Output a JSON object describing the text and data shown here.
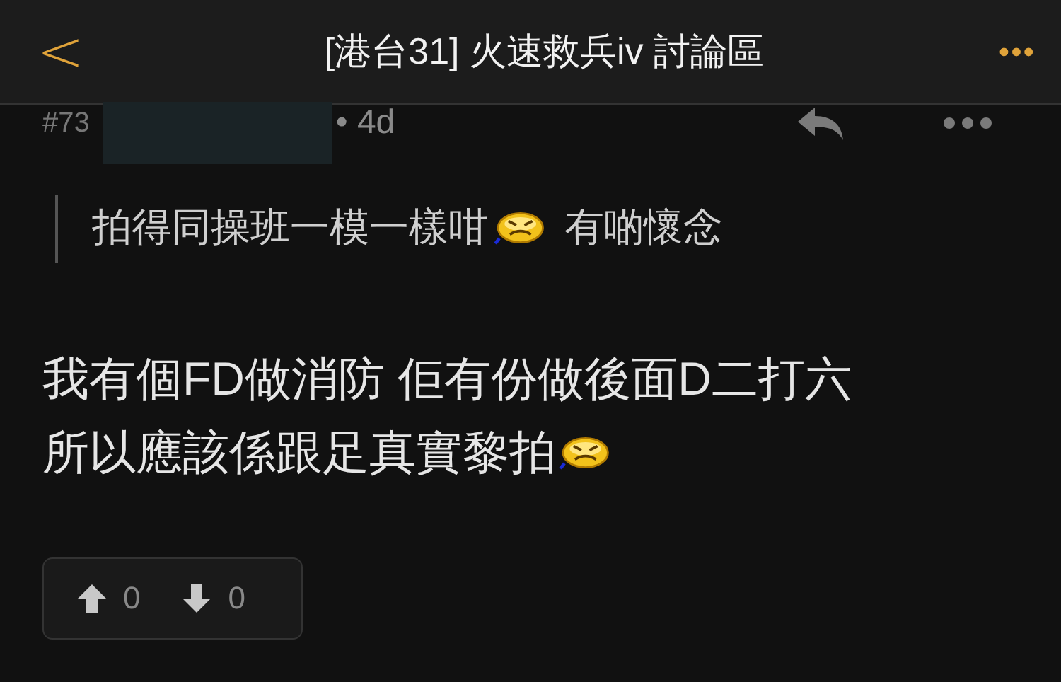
{
  "header": {
    "back": "<",
    "title": "[港台31] 火速救兵iv 討論區",
    "more": "•••"
  },
  "post": {
    "number": "#73",
    "username_hidden": true,
    "age": "• 4d",
    "quote": [
      {
        "kind": "text",
        "text": "拍得同操班一模一樣咁"
      },
      {
        "kind": "emoji"
      },
      {
        "kind": "text",
        "text": "有啲懷念"
      }
    ],
    "body": [
      [
        {
          "kind": "text",
          "text": "我有個FD做消防 佢有份做後面D二打六"
        }
      ],
      [
        {
          "kind": "text",
          "text": "所以應該係跟足真實黎拍"
        },
        {
          "kind": "emoji"
        }
      ]
    ],
    "votes": {
      "up": "0",
      "down": "0"
    }
  }
}
